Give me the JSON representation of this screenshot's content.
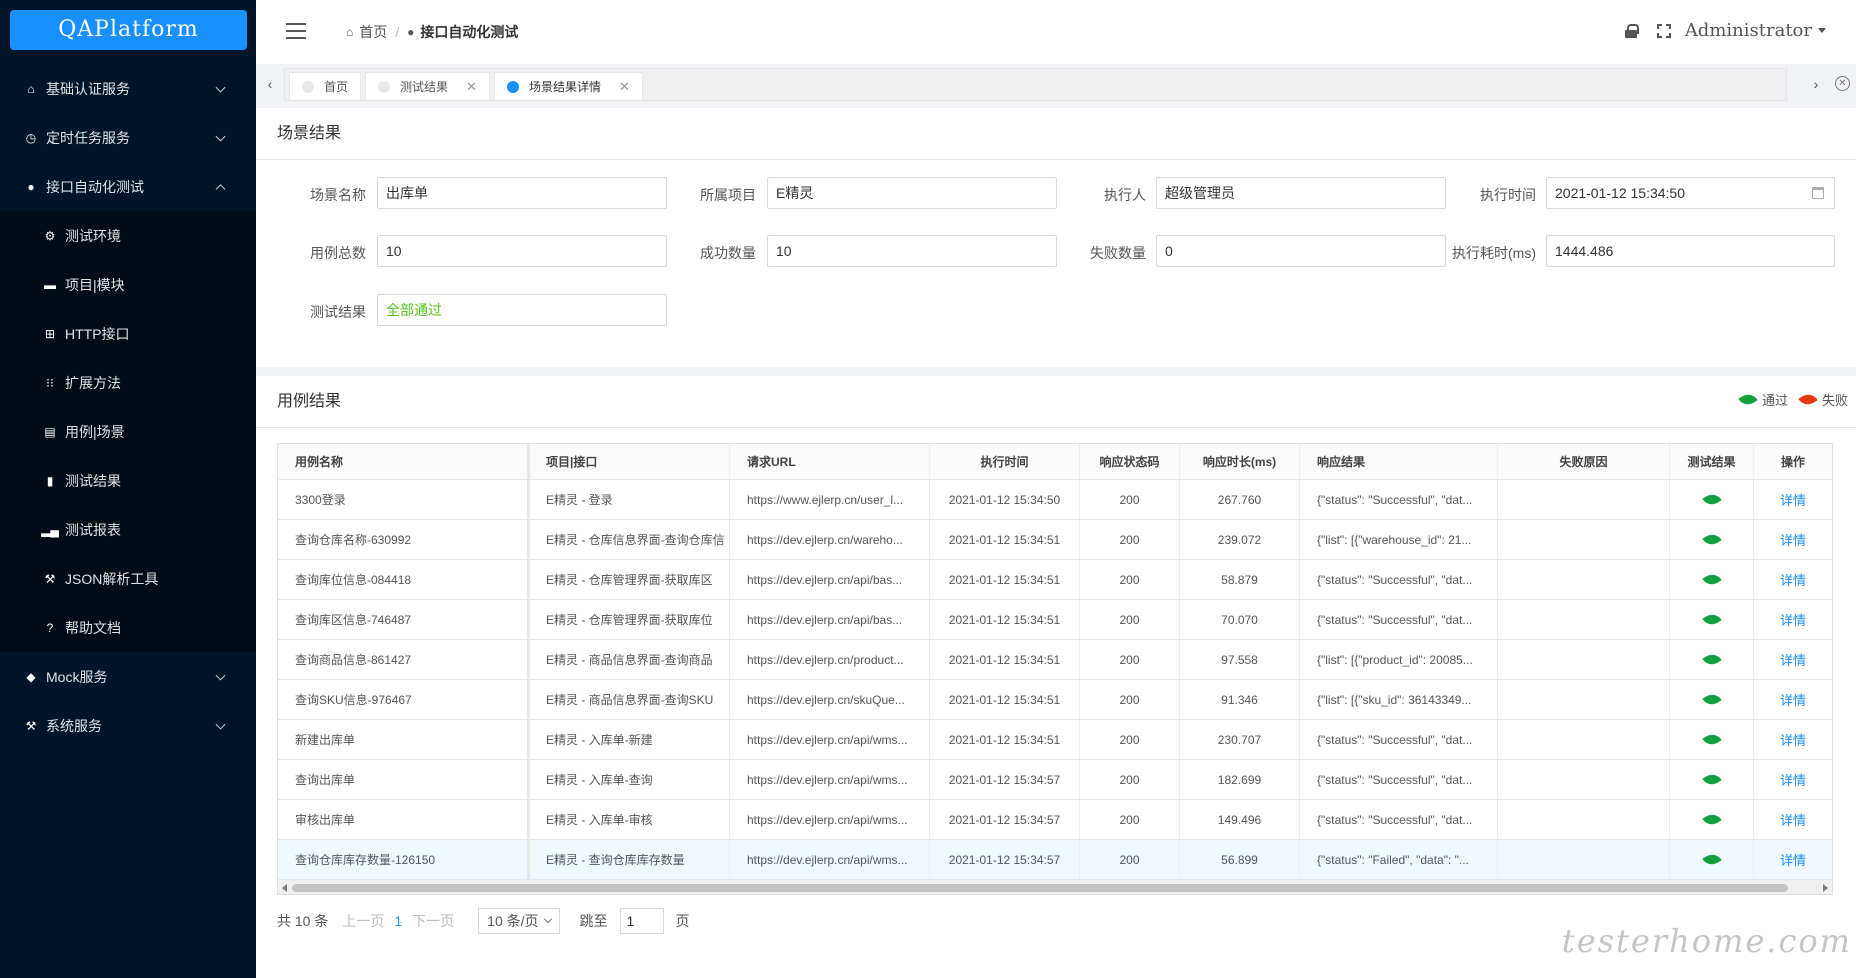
{
  "app": {
    "logo": "QAPlatform"
  },
  "sidebar": {
    "items": [
      {
        "label": "基础认证服务",
        "icon": "home-icon",
        "glyph": "⌂",
        "expanded": false
      },
      {
        "label": "定时任务服务",
        "icon": "clock-icon",
        "glyph": "◷",
        "expanded": false
      },
      {
        "label": "接口自动化测试",
        "icon": "blob-icon",
        "glyph": "●",
        "expanded": true,
        "children": [
          {
            "label": "测试环境",
            "icon": "gear-icon",
            "glyph": "⚙"
          },
          {
            "label": "项目|模块",
            "icon": "folder-icon",
            "glyph": "▬"
          },
          {
            "label": "HTTP接口",
            "icon": "api-icon",
            "glyph": "⊞"
          },
          {
            "label": "扩展方法",
            "icon": "grid-icon",
            "glyph": "⁝⁝"
          },
          {
            "label": "用例|场景",
            "icon": "case-icon",
            "glyph": "▤"
          },
          {
            "label": "测试结果",
            "icon": "file-icon",
            "glyph": "▮"
          },
          {
            "label": "测试报表",
            "icon": "bar-chart-icon",
            "glyph": "▂▄"
          },
          {
            "label": "JSON解析工具",
            "icon": "hammer-icon",
            "glyph": "⚒"
          },
          {
            "label": "帮助文档",
            "icon": "question-icon",
            "glyph": "?"
          }
        ]
      },
      {
        "label": "Mock服务",
        "icon": "cube-icon",
        "glyph": "◆",
        "expanded": false
      },
      {
        "label": "系统服务",
        "icon": "tool-icon",
        "glyph": "⚒",
        "expanded": false
      }
    ]
  },
  "header": {
    "breadcrumb": [
      {
        "label": "首页",
        "icon": "home-icon",
        "glyph": "⌂"
      },
      {
        "label": "接口自动化测试",
        "icon": "blob-icon",
        "glyph": "●"
      }
    ],
    "user": "Administrator"
  },
  "tabs": [
    {
      "label": "首页",
      "closable": false,
      "active": false
    },
    {
      "label": "测试结果",
      "closable": true,
      "active": false
    },
    {
      "label": "场景结果详情",
      "closable": true,
      "active": true
    }
  ],
  "scenario": {
    "title": "场景结果",
    "name_label": "场景名称",
    "name": "出库单",
    "project_label": "所属项目",
    "project": "E精灵",
    "executor_label": "执行人",
    "executor": "超级管理员",
    "exec_time_label": "执行时间",
    "exec_time": "2021-01-12 15:34:50",
    "total_label": "用例总数",
    "total": "10",
    "success_label": "成功数量",
    "success": "10",
    "fail_label": "失败数量",
    "fail": "0",
    "duration_label": "执行耗时(ms)",
    "duration": "1444.486",
    "result_label": "测试结果",
    "result": "全部通过"
  },
  "cases": {
    "title": "用例结果",
    "legend_pass": "通过",
    "legend_fail": "失败",
    "colors": {
      "pass": "#13a03c",
      "fail": "#e8380d"
    },
    "columns": [
      "用例名称",
      "项目|接口",
      "请求URL",
      "执行时间",
      "响应状态码",
      "响应时长(ms)",
      "响应结果",
      "失败原因",
      "测试结果",
      "操作"
    ],
    "rows": [
      {
        "name": "3300登录",
        "project": "E精灵 - 登录",
        "url": "https://www.ejlerp.cn/user_l...",
        "time": "2021-01-12 15:34:50",
        "code": "200",
        "duration": "267.760",
        "response": "{\"status\": \"Successful\", \"dat...",
        "fail_reason": "",
        "result": "pass",
        "op": "详情"
      },
      {
        "name": "查询仓库名称-630992",
        "project": "E精灵 - 仓库信息界面-查询仓库信",
        "url": "https://dev.ejlerp.cn/wareho...",
        "time": "2021-01-12 15:34:51",
        "code": "200",
        "duration": "239.072",
        "response": "{\"list\": [{\"warehouse_id\": 21...",
        "fail_reason": "",
        "result": "pass",
        "op": "详情"
      },
      {
        "name": "查询库位信息-084418",
        "project": "E精灵 - 仓库管理界面-获取库区",
        "url": "https://dev.ejlerp.cn/api/bas...",
        "time": "2021-01-12 15:34:51",
        "code": "200",
        "duration": "58.879",
        "response": "{\"status\": \"Successful\", \"dat...",
        "fail_reason": "",
        "result": "pass",
        "op": "详情"
      },
      {
        "name": "查询库区信息-746487",
        "project": "E精灵 - 仓库管理界面-获取库位",
        "url": "https://dev.ejlerp.cn/api/bas...",
        "time": "2021-01-12 15:34:51",
        "code": "200",
        "duration": "70.070",
        "response": "{\"status\": \"Successful\", \"dat...",
        "fail_reason": "",
        "result": "pass",
        "op": "详情"
      },
      {
        "name": "查询商品信息-861427",
        "project": "E精灵 - 商品信息界面-查询商品",
        "url": "https://dev.ejlerp.cn/product...",
        "time": "2021-01-12 15:34:51",
        "code": "200",
        "duration": "97.558",
        "response": "{\"list\": [{\"product_id\": 20085...",
        "fail_reason": "",
        "result": "pass",
        "op": "详情"
      },
      {
        "name": "查询SKU信息-976467",
        "project": "E精灵 - 商品信息界面-查询SKU",
        "url": "https://dev.ejlerp.cn/skuQue...",
        "time": "2021-01-12 15:34:51",
        "code": "200",
        "duration": "91.346",
        "response": "{\"list\": [{\"sku_id\": 36143349...",
        "fail_reason": "",
        "result": "pass",
        "op": "详情"
      },
      {
        "name": "新建出库单",
        "project": "E精灵 - 入库单-新建",
        "url": "https://dev.ejlerp.cn/api/wms...",
        "time": "2021-01-12 15:34:51",
        "code": "200",
        "duration": "230.707",
        "response": "{\"status\": \"Successful\", \"dat...",
        "fail_reason": "",
        "result": "pass",
        "op": "详情"
      },
      {
        "name": "查询出库单",
        "project": "E精灵 - 入库单-查询",
        "url": "https://dev.ejlerp.cn/api/wms...",
        "time": "2021-01-12 15:34:57",
        "code": "200",
        "duration": "182.699",
        "response": "{\"status\": \"Successful\", \"dat...",
        "fail_reason": "",
        "result": "pass",
        "op": "详情"
      },
      {
        "name": "审核出库单",
        "project": "E精灵 - 入库单-审核",
        "url": "https://dev.ejlerp.cn/api/wms...",
        "time": "2021-01-12 15:34:57",
        "code": "200",
        "duration": "149.496",
        "response": "{\"status\": \"Successful\", \"dat...",
        "fail_reason": "",
        "result": "pass",
        "op": "详情"
      },
      {
        "name": "查询仓库库存数量-126150",
        "project": "E精灵 - 查询仓库库存数量",
        "url": "https://dev.ejlerp.cn/api/wms...",
        "time": "2021-01-12 15:34:57",
        "code": "200",
        "duration": "56.899",
        "response": "{\"status\": \"Failed\", \"data\": \"...",
        "fail_reason": "",
        "result": "pass",
        "op": "详情"
      }
    ]
  },
  "pagination": {
    "total_text": "共 10 条",
    "prev": "上一页",
    "current": "1",
    "next": "下一页",
    "page_size": "10 条/页",
    "jump_label": "跳至",
    "jump_value": "1",
    "page_unit": "页"
  },
  "watermark": "testerhome.com"
}
